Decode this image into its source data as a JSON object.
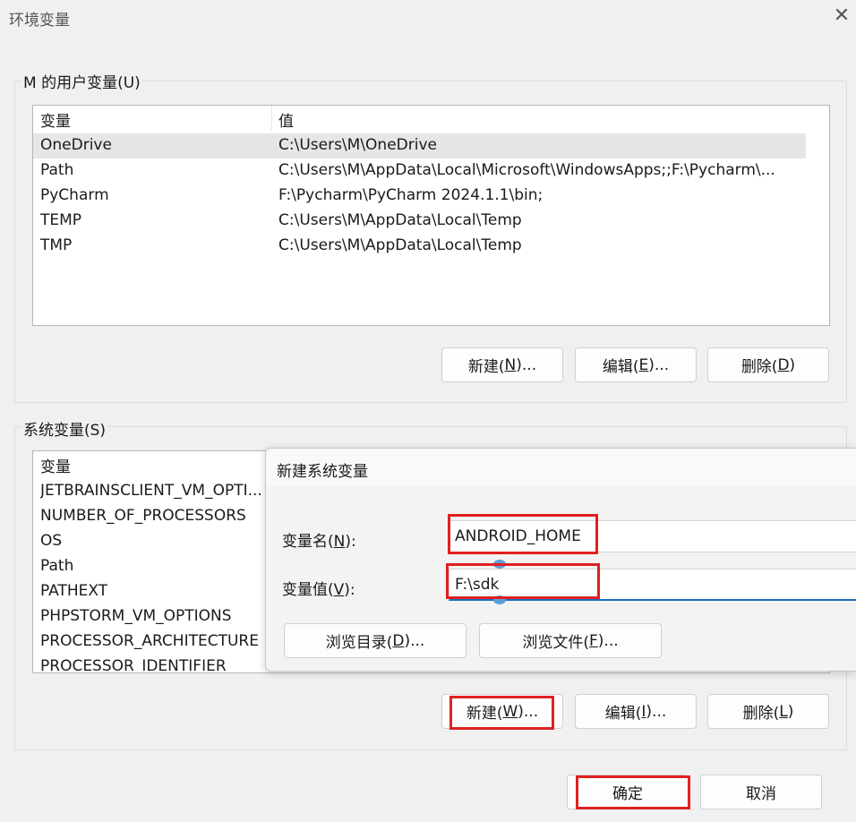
{
  "window": {
    "title": "环境变量",
    "close_glyph": "✕"
  },
  "user_vars": {
    "legend": "M 的用户变量(U)",
    "col_name": "变量",
    "col_value": "值",
    "rows": [
      {
        "name": "OneDrive",
        "value": "C:\\Users\\M\\OneDrive"
      },
      {
        "name": "Path",
        "value": "C:\\Users\\M\\AppData\\Local\\Microsoft\\WindowsApps;;F:\\Pycharm\\..."
      },
      {
        "name": "PyCharm",
        "value": "F:\\Pycharm\\PyCharm 2024.1.1\\bin;"
      },
      {
        "name": "TEMP",
        "value": "C:\\Users\\M\\AppData\\Local\\Temp"
      },
      {
        "name": "TMP",
        "value": "C:\\Users\\M\\AppData\\Local\\Temp"
      }
    ],
    "new_btn_pre": "新建(",
    "new_btn_key": "N",
    "new_btn_post": ")...",
    "edit_btn_pre": "编辑(",
    "edit_btn_key": "E",
    "edit_btn_post": ")...",
    "delete_btn_pre": "删除(",
    "delete_btn_key": "D",
    "delete_btn_post": ")"
  },
  "system_vars": {
    "legend": "系统变量(S)",
    "col_name": "变量",
    "rows": [
      {
        "name": "JETBRAINSCLIENT_VM_OPTI..."
      },
      {
        "name": "NUMBER_OF_PROCESSORS"
      },
      {
        "name": "OS"
      },
      {
        "name": "Path"
      },
      {
        "name": "PATHEXT"
      },
      {
        "name": "PHPSTORM_VM_OPTIONS"
      },
      {
        "name": "PROCESSOR_ARCHITECTURE"
      },
      {
        "name": "PROCESSOR_IDENTIFIER"
      }
    ],
    "new_btn_pre": "新建(",
    "new_btn_key": "W",
    "new_btn_post": ")...",
    "edit_btn_pre": "编辑(",
    "edit_btn_key": "I",
    "edit_btn_post": ")...",
    "delete_btn_pre": "删除(",
    "delete_btn_key": "L",
    "delete_btn_post": ")"
  },
  "new_var_dialog": {
    "title": "新建系统变量",
    "name_label_pre": "变量名(",
    "name_label_key": "N",
    "name_label_post": "):",
    "name_value": "ANDROID_HOME",
    "value_label_pre": "变量值(",
    "value_label_key": "V",
    "value_label_post": "):",
    "value_value": "F:\\sdk",
    "browse_dir_pre": "浏览目录(",
    "browse_dir_key": "D",
    "browse_dir_post": ")...",
    "browse_file_pre": "浏览文件(",
    "browse_file_key": "F",
    "browse_file_post": ")..."
  },
  "footer": {
    "ok_label": "确定",
    "cancel_label": "取消"
  },
  "colors": {
    "highlight": "#e02020",
    "focus_underline": "#1a6fc0"
  }
}
